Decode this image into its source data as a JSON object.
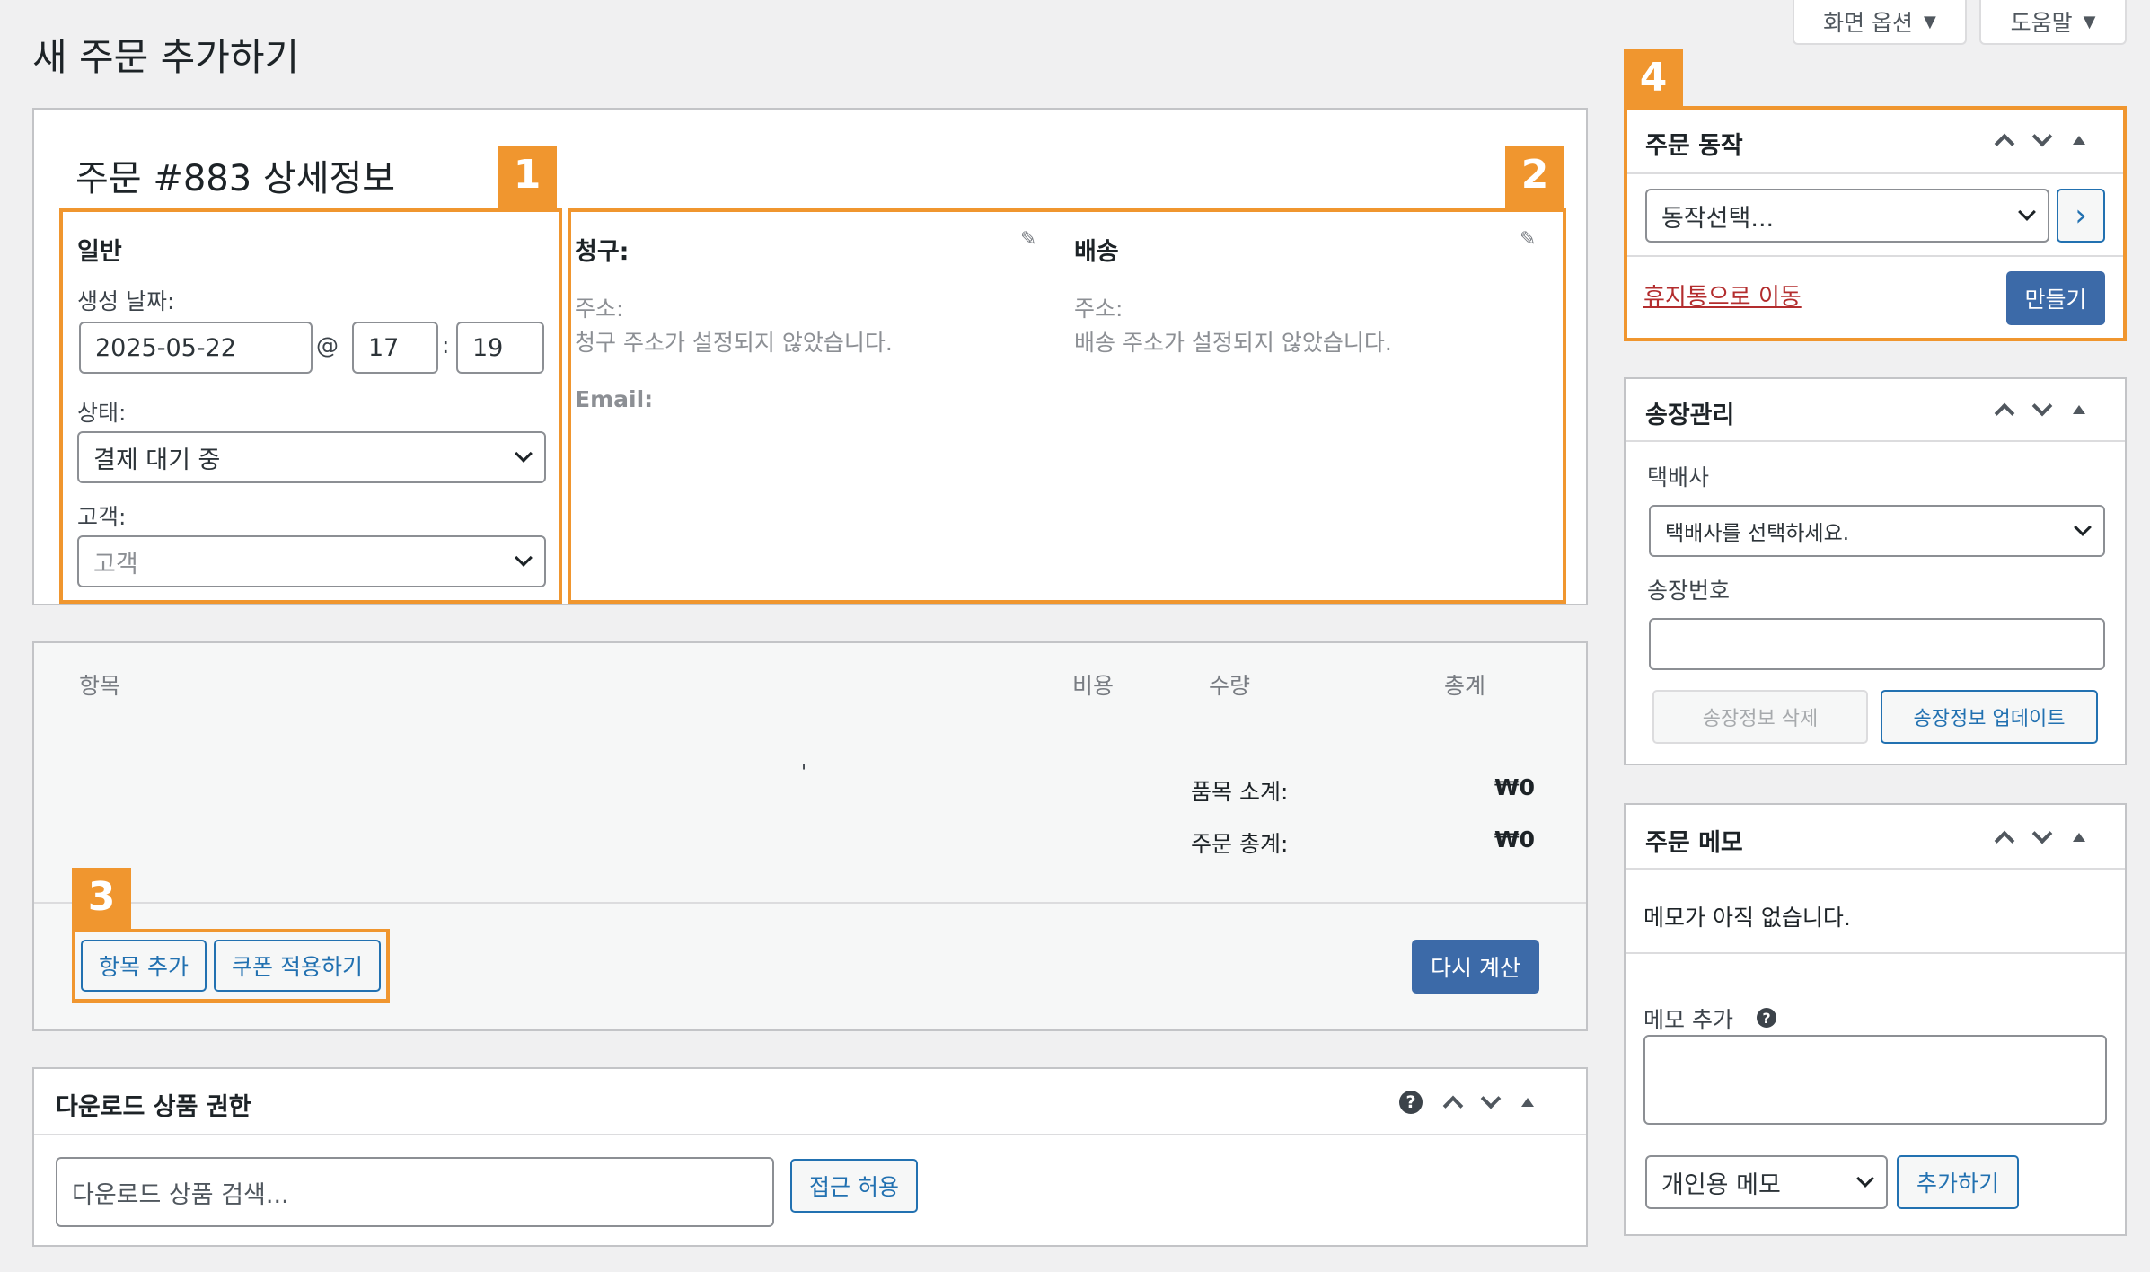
{
  "page": {
    "title": "새 주문 추가하기",
    "screen_options": "화면 옵션",
    "help": "도움말"
  },
  "order": {
    "heading": "주문 #883 상세정보",
    "general": {
      "title": "일반",
      "date_label": "생성 날짜:",
      "date_value": "2025-05-22",
      "at": "@",
      "hour": "17",
      "colon": ":",
      "minute": "19",
      "status_label": "상태:",
      "status_value": "결제 대기 중",
      "customer_label": "고객:",
      "customer_placeholder": "고객"
    },
    "billing": {
      "title": "청구:",
      "address_label": "주소:",
      "address_value": "청구 주소가 설정되지 않았습니다.",
      "email_label": "Email:"
    },
    "shipping": {
      "title": "배송",
      "address_label": "주소:",
      "address_value": "배송 주소가 설정되지 않았습니다."
    }
  },
  "items": {
    "columns": {
      "item": "항목",
      "cost": "비용",
      "qty": "수량",
      "total": "총계"
    },
    "stray_mark": "'",
    "subtotal_label": "품목 소계:",
    "subtotal_value": "₩0",
    "order_total_label": "주문 총계:",
    "order_total_value": "₩0",
    "add_item": "항목 추가",
    "apply_coupon": "쿠폰 적용하기",
    "recalculate": "다시 계산"
  },
  "downloads": {
    "title": "다운로드 상품 권한",
    "search_placeholder": "다운로드 상품 검색...",
    "grant_access": "접근 허용"
  },
  "order_actions": {
    "title": "주문 동작",
    "select_value": "동작선택...",
    "go": "›",
    "trash": "휴지통으로 이동",
    "create": "만들기"
  },
  "invoice": {
    "title": "송장관리",
    "carrier_label": "택배사",
    "carrier_placeholder": "택배사를 선택하세요.",
    "tracking_label": "송장번호",
    "delete": "송장정보 삭제",
    "update": "송장정보 업데이트"
  },
  "notes": {
    "title": "주문 메모",
    "empty": "메모가 아직 없습니다.",
    "add_label": "메모 추가",
    "type_value": "개인용 메모",
    "add_button": "추가하기"
  },
  "badges": [
    "1",
    "2",
    "3",
    "4"
  ],
  "colors": {
    "highlight": "#f0962f",
    "primary": "#3c6aa8",
    "link": "#2271b1",
    "trash": "#b32d2e"
  }
}
